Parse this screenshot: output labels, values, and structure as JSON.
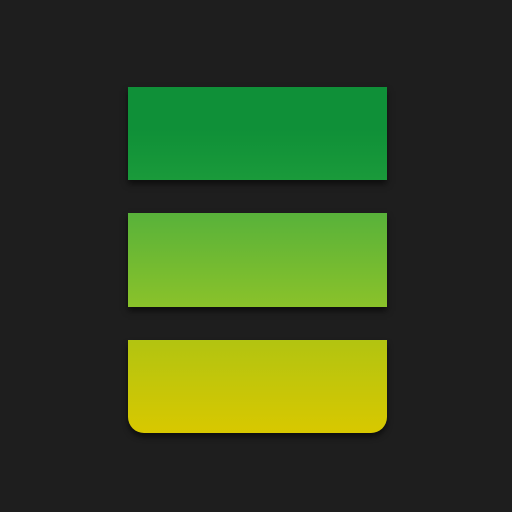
{
  "logo": {
    "icon": "stacked-bars-logo-icon",
    "background_color": "#1e1e1e",
    "bars": [
      {
        "id": "top",
        "gradient": [
          "#0f9038",
          "#1a9a3a"
        ],
        "highlight": "#0f9038"
      },
      {
        "id": "middle",
        "gradient": [
          "#58b23a",
          "#8ac22a"
        ]
      },
      {
        "id": "bottom",
        "gradient": [
          "#b2c411",
          "#d8c800"
        ]
      }
    ]
  }
}
